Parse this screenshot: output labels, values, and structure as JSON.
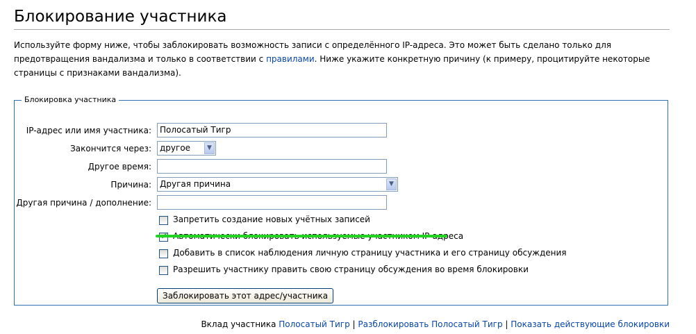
{
  "page": {
    "title": "Блокирование участника",
    "intro_part1": "Используйте форму ниже, чтобы заблокировать возможность записи с определённого IP-адреса. Это может быть сделано только для предотвращения вандализма и только в соответствии с ",
    "intro_link": "правилами",
    "intro_part2": ". Ниже укажите конкретную причину (к примеру, процитируйте некоторые страницы с признаками вандализма)."
  },
  "form": {
    "legend": "Блокировка участника",
    "ip_label": "IP-адрес или имя участника:",
    "ip_value": "Полосатый Тигр",
    "expiry_label": "Закончится через:",
    "expiry_value": "другое",
    "other_time_label": "Другое время:",
    "other_time_value": "",
    "reason_label": "Причина:",
    "reason_value": "Другая причина",
    "other_reason_label": "Другая причина / дополнение:",
    "other_reason_value": "",
    "checkboxes": [
      {
        "label": "Запретить создание новых учётных записей",
        "checked": false
      },
      {
        "label": "Автоматически блокировать используемые участником IP-адреса",
        "checked": true
      },
      {
        "label": "Добавить в список наблюдения личную страницу участника и его страницу обсуждения",
        "checked": false
      },
      {
        "label": "Разрешить участнику править свою страницу обсуждения во время блокировки",
        "checked": false
      }
    ],
    "submit_label": "Заблокировать этот адрес/участника"
  },
  "footer": {
    "contrib_prefix": "Вклад участника ",
    "contrib_link": "Полосатый Тигр",
    "sep1": " | ",
    "unblock_link": "Разблокировать Полосатый Тигр",
    "sep2": " | ",
    "blocklist_link": "Показать действующие блокировки"
  },
  "colors": {
    "link": "#0645ad",
    "fieldset_border": "#2f6fab",
    "highlight": "#22d322"
  }
}
